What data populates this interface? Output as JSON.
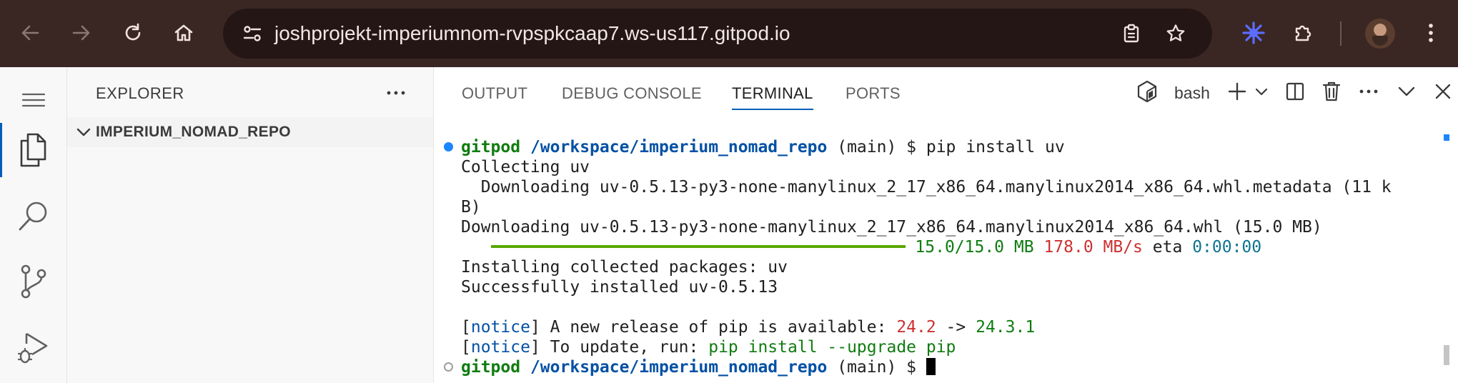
{
  "browser": {
    "url": "joshprojekt-imperiumnom-rvpspkcaap7.ws-us117.gitpod.io"
  },
  "sidebar": {
    "title": "EXPLORER",
    "folder": "IMPERIUM_NOMAD_REPO"
  },
  "panel": {
    "tabs": [
      {
        "label": "OUTPUT"
      },
      {
        "label": "DEBUG CONSOLE"
      },
      {
        "label": "TERMINAL"
      },
      {
        "label": "PORTS"
      }
    ],
    "terminal_name": "bash"
  },
  "terminal": {
    "prompt_user": "gitpod",
    "prompt_path": "/workspace/imperium_nomad_repo",
    "prompt_branch": " (main) $ ",
    "command": "pip install uv",
    "lines": [
      "Collecting uv",
      "  Downloading uv-0.5.13-py3-none-manylinux_2_17_x86_64.manylinux2014_x86_64.whl.metadata (11 k",
      "B)",
      "Downloading uv-0.5.13-py3-none-manylinux_2_17_x86_64.manylinux2014_x86_64.whl (15.0 MB)"
    ],
    "progress": {
      "fraction": 1.0,
      "size": "15.0/15.0 MB",
      "speed": "178.0 MB/s",
      "eta_label": "eta",
      "eta": "0:00:00"
    },
    "installing": "Installing collected packages: uv",
    "success": "Successfully installed uv-0.5.13",
    "notice_tag": "notice",
    "notice1_text": " A new release of pip is available: ",
    "notice1_old": "24.2",
    "notice1_arrow": " -> ",
    "notice1_new": "24.3.1",
    "notice2_text": " To update, run: ",
    "notice2_cmd": "pip install --upgrade pip"
  },
  "colors": {
    "chrome_bg": "#3a2723",
    "accent": "#005fb8",
    "prompt_green": "#107c10",
    "path_blue": "#0451a5",
    "error_red": "#cd3131",
    "progress_green": "#58a700"
  }
}
